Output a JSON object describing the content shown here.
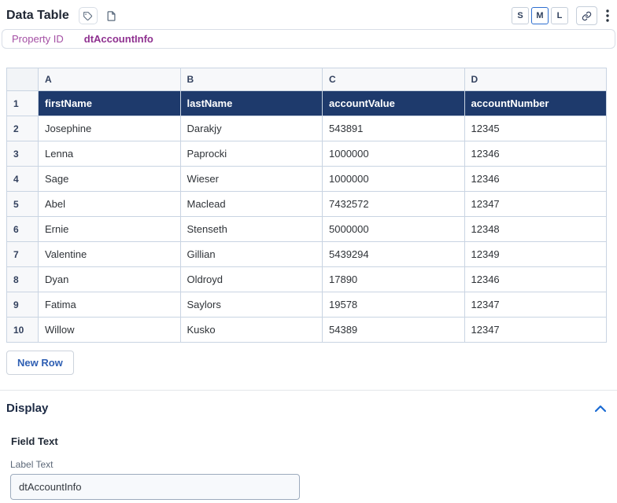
{
  "header": {
    "title": "Data Table",
    "size_buttons": [
      {
        "label": "S",
        "selected": false
      },
      {
        "label": "M",
        "selected": true
      },
      {
        "label": "L",
        "selected": false
      }
    ]
  },
  "icons": {
    "tag": "tag-icon",
    "note": "note-icon",
    "link": "link-icon",
    "menu": "kebab-menu-icon",
    "collapse": "chevron-up-icon"
  },
  "property": {
    "label": "Property ID",
    "value": "dtAccountInfo"
  },
  "table": {
    "column_letters": [
      "A",
      "B",
      "C",
      "D"
    ],
    "header_row": {
      "num": "1",
      "cells": [
        "firstName",
        "lastName",
        "accountValue",
        "accountNumber"
      ]
    },
    "rows": [
      {
        "num": "2",
        "cells": [
          "Josephine",
          "Darakjy",
          "543891",
          "12345"
        ]
      },
      {
        "num": "3",
        "cells": [
          "Lenna",
          "Paprocki",
          "1000000",
          "12346"
        ]
      },
      {
        "num": "4",
        "cells": [
          "Sage",
          "Wieser",
          "1000000",
          "12346"
        ]
      },
      {
        "num": "5",
        "cells": [
          "Abel",
          "Maclead",
          "7432572",
          "12347"
        ]
      },
      {
        "num": "6",
        "cells": [
          "Ernie",
          "Stenseth",
          "5000000",
          "12348"
        ]
      },
      {
        "num": "7",
        "cells": [
          "Valentine",
          "Gillian",
          "5439294",
          "12349"
        ]
      },
      {
        "num": "8",
        "cells": [
          "Dyan",
          "Oldroyd",
          "17890",
          "12346"
        ]
      },
      {
        "num": "9",
        "cells": [
          "Fatima",
          "Saylors",
          "19578",
          "12347"
        ]
      },
      {
        "num": "10",
        "cells": [
          "Willow",
          "Kusko",
          "54389",
          "12347"
        ]
      }
    ]
  },
  "actions": {
    "new_row": "New Row"
  },
  "display_section": {
    "title": "Display",
    "field_text_title": "Field Text",
    "label_text_label": "Label Text",
    "label_text_value": "dtAccountInfo"
  },
  "colors": {
    "header_row_bg": "#1e3a6c",
    "property_purple": "#a44fa4",
    "accent_blue": "#2e6fd0",
    "grid_border": "#c9d4e2"
  }
}
